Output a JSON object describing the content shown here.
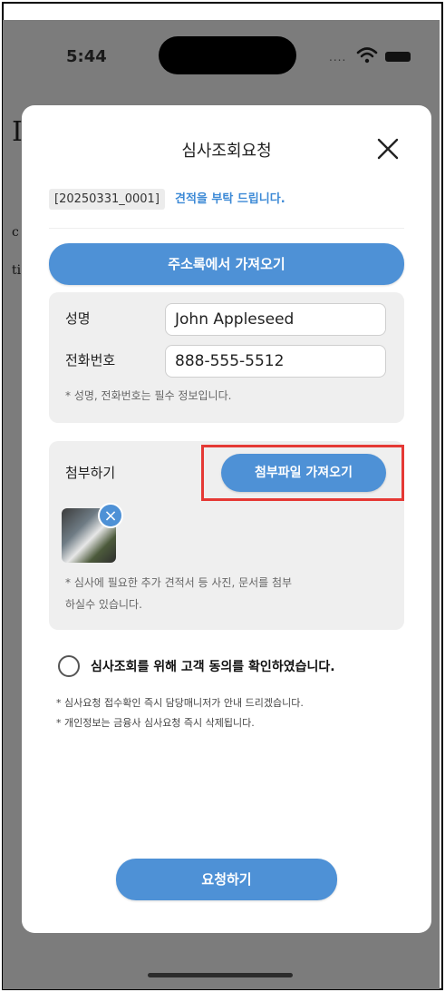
{
  "status_bar": {
    "time": "5:44",
    "signal": "....",
    "wifi_icon": "wifi-icon",
    "battery_icon": "battery-icon"
  },
  "background": {
    "letters": [
      "I",
      "c",
      "ti"
    ]
  },
  "modal": {
    "title": "심사조회요청",
    "close_icon": "close-icon",
    "ref_id": "[20250331_0001]",
    "ref_message": "견적을 부탁 드립니다.",
    "address_button": "주소록에서 가져오기",
    "name_label": "성명",
    "name_value": "John Appleseed",
    "phone_label": "전화번호",
    "phone_value": "888-555-5512",
    "required_note": "* 성명, 전화번호는 필수 정보입니다.",
    "attach_label": "첨부하기",
    "attach_button": "첨부파일 가져오기",
    "remove_icon": "close-icon",
    "attach_note_line1": "* 심사에 필요한 추가 견적서 등 사진, 문서를 첨부",
    "attach_note_line2": "하실수 있습니다.",
    "consent_text": "심사조회를 위해 고객 동의를 확인하였습니다.",
    "info_note_1": "* 심사요청 접수확인 즉시 담당매니저가 안내 드리겠습니다.",
    "info_note_2": "* 개인정보는 금융사 심사요청 즉시 삭제됩니다.",
    "submit_button": "요청하기"
  },
  "colors": {
    "accent": "#4e91d6",
    "highlight": "#e53935",
    "overlay": "#7c7c7c"
  }
}
